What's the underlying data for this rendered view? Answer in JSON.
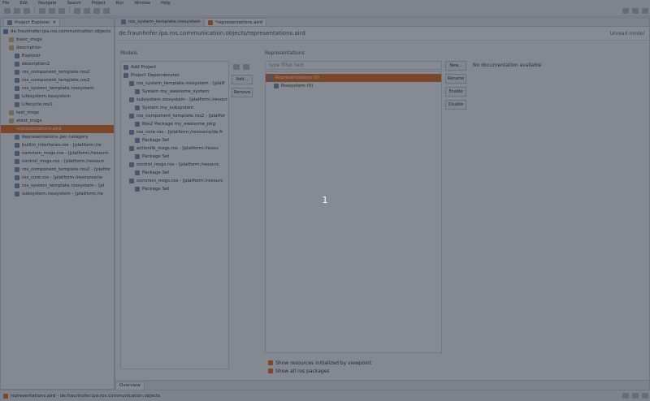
{
  "menu": [
    "File",
    "Edit",
    "Navigate",
    "Search",
    "Project",
    "Run",
    "Window",
    "Help"
  ],
  "project_explorer": {
    "tab_label": "Project Explorer",
    "items": [
      {
        "label": "de.fraunhofer.ipa.ros.communication.objects",
        "indent": 0,
        "color": "#6b7fa8"
      },
      {
        "label": "basic_msgs",
        "indent": 1,
        "color": "#d9b26a"
      },
      {
        "label": "description",
        "indent": 1,
        "color": "#d9b26a"
      },
      {
        "label": "Explorer",
        "indent": 2,
        "color": "#7a8ca8"
      },
      {
        "label": "description2",
        "indent": 2,
        "color": "#7a8ca8"
      },
      {
        "label": "ros_component_template.ros2",
        "indent": 2,
        "color": "#7a8ca8"
      },
      {
        "label": "ros_component_template.ros2",
        "indent": 2,
        "color": "#7a8ca8"
      },
      {
        "label": "ros_system_template.rossystem",
        "indent": 2,
        "color": "#7a8ca8"
      },
      {
        "label": "Lifesystem.rossystem",
        "indent": 2,
        "color": "#7a8ca8"
      },
      {
        "label": "Lifecycle.ros1",
        "indent": 2,
        "color": "#7a8ca8"
      },
      {
        "label": "test_msgs",
        "indent": 1,
        "color": "#d9b26a"
      },
      {
        "label": "xtext_msgs",
        "indent": 1,
        "color": "#d9b26a"
      },
      {
        "label": "representations.aird",
        "indent": 1,
        "color": "#e46a1a",
        "selected": true
      },
      {
        "label": "Representations per category",
        "indent": 2,
        "color": "#7a8ca8"
      },
      {
        "label": "builtin_interfaces.ros - [platform:/re",
        "indent": 2,
        "color": "#7a8ca8"
      },
      {
        "label": "common_msgs.ros - [platform:/resourc",
        "indent": 2,
        "color": "#7a8ca8"
      },
      {
        "label": "control_msgs.ros - [platform:/resourc",
        "indent": 2,
        "color": "#7a8ca8"
      },
      {
        "label": "ros_component_template.ros2 - [platfor",
        "indent": 2,
        "color": "#7a8ca8"
      },
      {
        "label": "ros_core.ros - [platform:/resource/re",
        "indent": 2,
        "color": "#7a8ca8"
      },
      {
        "label": "ros_system_template.rossystem - [pl",
        "indent": 2,
        "color": "#7a8ca8"
      },
      {
        "label": "subsystem.rossystem - [platform:/re",
        "indent": 2,
        "color": "#7a8ca8"
      }
    ]
  },
  "editor": {
    "tabs": [
      "ros_system_template.rossystem",
      "*representations.aird"
    ],
    "header": "de.fraunhofer.ipa.ros.communication.objects/representations.aird",
    "header_right": "Unread model",
    "models": {
      "title": "Models",
      "items": [
        {
          "label": "Add Project",
          "indent": 0
        },
        {
          "label": "Project Dependencies",
          "indent": 0
        },
        {
          "label": "ros_system_template.rossystem - [platf",
          "indent": 1
        },
        {
          "label": "System my_awesome_system",
          "indent": 2
        },
        {
          "label": "subsystem.rossystem - [platform:/resour",
          "indent": 1
        },
        {
          "label": "System my_subsystem",
          "indent": 2
        },
        {
          "label": "ros_component_template.ros2 - [platfor",
          "indent": 1
        },
        {
          "label": "Ros2 Package my_awesome_pkg",
          "indent": 2
        },
        {
          "label": "ros_core.ros - [platform:/resource/de.fr",
          "indent": 1
        },
        {
          "label": "Package Set",
          "indent": 2
        },
        {
          "label": "actionlib_msgs.ros - [platform:/resou",
          "indent": 1
        },
        {
          "label": "Package Set",
          "indent": 2
        },
        {
          "label": "control_msgs.ros - [platform:/resourc",
          "indent": 1
        },
        {
          "label": "Package Set",
          "indent": 2
        },
        {
          "label": "common_msgs.ros - [platform:/resourc",
          "indent": 1
        },
        {
          "label": "Package Set",
          "indent": 2
        }
      ],
      "buttons": [
        "Add...",
        "Remove"
      ]
    },
    "representations": {
      "title": "Representations",
      "filter_placeholder": "type filter text",
      "items": [
        {
          "label": "Representations (0)",
          "indent": 0,
          "selected": true
        },
        {
          "label": "Rossystem (0)",
          "indent": 1
        }
      ],
      "buttons": [
        "New...",
        "Rename",
        "Enable",
        "Disable"
      ],
      "doc": "No documentation available"
    },
    "bottom_links": [
      "Show resources initialized by viewpoint",
      "Show all ros packages"
    ],
    "bottom_tab": "Overview"
  },
  "status_bar": {
    "text": "representations.aird - de.fraunhofer.ipa.ros.communication.objects"
  },
  "overlay_marker": "1"
}
